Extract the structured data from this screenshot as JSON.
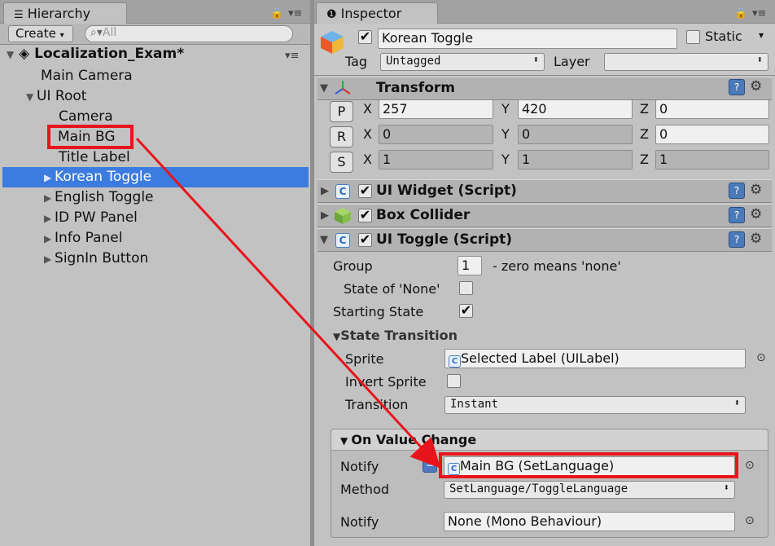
{
  "hierarchy": {
    "tab_label": "Hierarchy",
    "create_label": "Create",
    "search_placeholder": "All",
    "scene_name": "Localization_Exam*",
    "items": [
      {
        "label": "Main Camera"
      },
      {
        "label": "UI Root"
      },
      {
        "label": "Camera"
      },
      {
        "label": "Main BG"
      },
      {
        "label": "Title Label"
      },
      {
        "label": "Korean Toggle"
      },
      {
        "label": "English Toggle"
      },
      {
        "label": "ID PW Panel"
      },
      {
        "label": "Info Panel"
      },
      {
        "label": "SignIn Button"
      }
    ]
  },
  "inspector": {
    "tab_label": "Inspector",
    "object_name": "Korean Toggle",
    "static_label": "Static",
    "tag_label": "Tag",
    "tag_value": "Untagged",
    "layer_label": "Layer",
    "layer_value": "",
    "transform": {
      "title": "Transform",
      "p_label": "P",
      "r_label": "R",
      "s_label": "S",
      "x_label": "X",
      "y_label": "Y",
      "z_label": "Z",
      "position": {
        "x": "257",
        "y": "420",
        "z": "0"
      },
      "rotation": {
        "x": "0",
        "y": "0",
        "z": "0"
      },
      "scale": {
        "x": "1",
        "y": "1",
        "z": "1"
      }
    },
    "ui_widget_title": "UI Widget (Script)",
    "box_collider_title": "Box Collider",
    "ui_toggle": {
      "title": "UI Toggle (Script)",
      "group_label": "Group",
      "group_value": "1",
      "group_hint": "- zero means 'none'",
      "state_none_label": "State of 'None'",
      "starting_state_label": "Starting State",
      "state_transition_label": "State Transition",
      "sprite_label": "Sprite",
      "sprite_value": "Selected Label (UILabel)",
      "invert_sprite_label": "Invert Sprite",
      "transition_label": "Transition",
      "transition_value": "Instant",
      "on_value_change_label": "On Value Change",
      "notify_label": "Notify",
      "notify_value": "Main BG (SetLanguage)",
      "method_label": "Method",
      "method_value": "SetLanguage/ToggleLanguage",
      "notify2_label": "Notify",
      "notify2_value": "None (Mono Behaviour)"
    }
  },
  "colors": {
    "selection": "#3c7be0",
    "highlight_box": "#e8141c",
    "arrow": "#e8141c"
  }
}
